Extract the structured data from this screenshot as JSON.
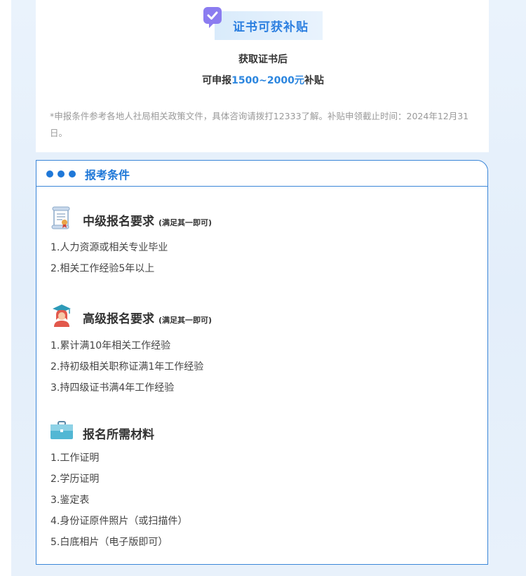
{
  "promo": {
    "badge": "证书可获补贴",
    "line1": "获取证书后",
    "line2_prefix": "可申报",
    "line2_amount": "1500~2000元",
    "line2_suffix": "补贴",
    "note": "*申报条件参考各地人社局相关政策文件，具体咨询请拨打12333了解。补贴申领截止时间：2024年12月31日。"
  },
  "requirements": {
    "title": "报考条件",
    "sections": [
      {
        "icon": "certificate-scroll-icon",
        "title": "中级报名要求",
        "note": "(满足其一即可)",
        "items": [
          "1.人力资源或相关专业毕业",
          "2.相关工作经验5年以上"
        ]
      },
      {
        "icon": "graduate-avatar-icon",
        "title": "高级报名要求",
        "note": "(满足其一即可)",
        "items": [
          "1.累计满10年相关工作经验",
          "2.持初级相关职称证满1年工作经验",
          "3.持四级证书满4年工作经验"
        ]
      },
      {
        "icon": "briefcase-icon",
        "title": "报名所需材料",
        "note": "",
        "items": [
          "1.工作证明",
          "2.学历证明",
          "3.鉴定表",
          "4.身份证原件照片（或扫描件）",
          "5.白底相片（电子版即可）"
        ]
      }
    ]
  },
  "colors": {
    "accent": "#1f78d8",
    "highlight": "#2c86df",
    "note": "#999999"
  }
}
